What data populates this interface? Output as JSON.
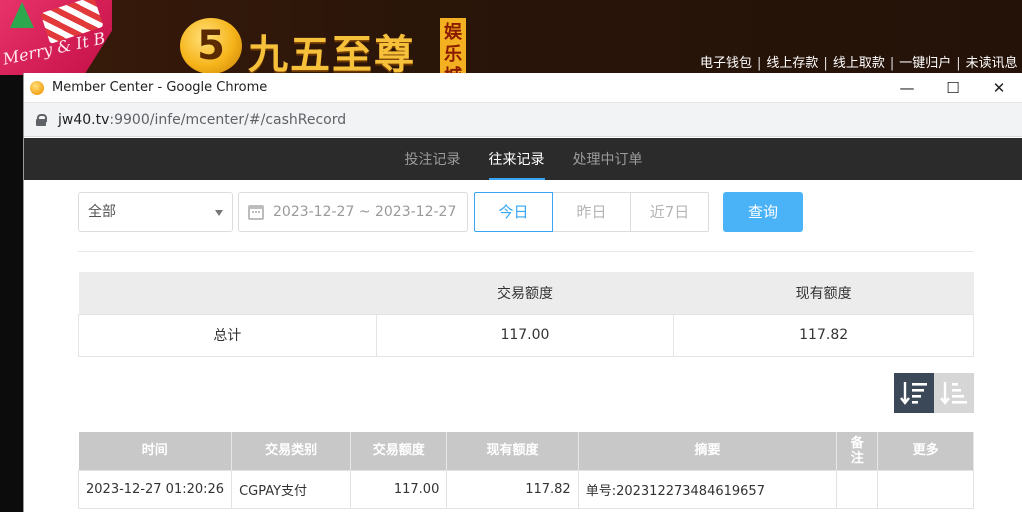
{
  "site": {
    "logo_mark": "5",
    "logo_name": "九五至尊",
    "logo_tag": "娱乐城",
    "xmas_text": "Merry & It B",
    "top_links": [
      "电子钱包",
      "线上存款",
      "线上取款",
      "一键归户",
      "未读讯息"
    ],
    "separator": "|"
  },
  "window": {
    "title": "Member Center - Google Chrome",
    "controls": {
      "minimize": "—",
      "maximize": "☐",
      "close": "✕"
    }
  },
  "urlbar": {
    "host": "jw40.tv",
    "path": ":9900/infe/mcenter/#/cashRecord"
  },
  "tabs": [
    {
      "label": "投注记录",
      "active": false
    },
    {
      "label": "往来记录",
      "active": true
    },
    {
      "label": "处理中订单",
      "active": false
    }
  ],
  "filters": {
    "type_select": "全部",
    "date_range": "2023-12-27 ~ 2023-12-27",
    "quick_ranges": [
      "今日",
      "昨日",
      "近7日"
    ],
    "active_range": "今日",
    "query_label": "查询"
  },
  "summary": {
    "headers": [
      "",
      "交易额度",
      "现有额度"
    ],
    "row": {
      "label": "总计",
      "amount": "117.00",
      "balance": "117.82"
    }
  },
  "records": {
    "headers": [
      "时间",
      "交易类别",
      "交易额度",
      "现有额度",
      "摘要",
      "备注",
      "更多"
    ],
    "rows": [
      {
        "time": "2023-12-27 01:20:26",
        "type": "CGPAY支付",
        "amount": "117.00",
        "balance": "117.82",
        "summary": "单号:202312273484619657",
        "remark": "",
        "more": ""
      }
    ]
  },
  "colors": {
    "accent": "#38a6f2",
    "button": "#4ab2f7",
    "tabbar": "#2b2b2b",
    "sort_active": "#3a4858"
  }
}
